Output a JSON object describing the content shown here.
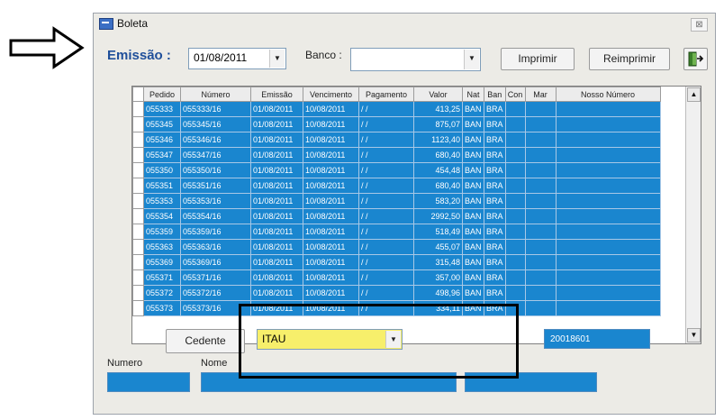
{
  "window": {
    "title": "Boleta",
    "close_glyph": "⊠"
  },
  "filter": {
    "emissao_label": "Emissão :",
    "emissao_value": "01/08/2011",
    "banco_label": "Banco :",
    "banco_value": ""
  },
  "toolbar": {
    "imprimir_label": "Imprimir",
    "reimprimir_label": "Reimprimir",
    "exit_icon": "exit-door-icon"
  },
  "grid": {
    "columns": [
      "Pedido",
      "Número",
      "Emissão",
      "Vencimento",
      "Pagamento",
      "Valor",
      "Nat",
      "Ban",
      "Con",
      "Mar",
      "Nosso Número"
    ],
    "rows": [
      [
        "055333",
        "055333/16",
        "01/08/2011",
        "10/08/2011",
        "/ /",
        "413,25",
        "BAN",
        "BRA",
        "",
        "",
        ""
      ],
      [
        "055345",
        "055345/16",
        "01/08/2011",
        "10/08/2011",
        "/ /",
        "875,07",
        "BAN",
        "BRA",
        "",
        "",
        ""
      ],
      [
        "055346",
        "055346/16",
        "01/08/2011",
        "10/08/2011",
        "/ /",
        "1123,40",
        "BAN",
        "BRA",
        "",
        "",
        ""
      ],
      [
        "055347",
        "055347/16",
        "01/08/2011",
        "10/08/2011",
        "/ /",
        "680,40",
        "BAN",
        "BRA",
        "",
        "",
        ""
      ],
      [
        "055350",
        "055350/16",
        "01/08/2011",
        "10/08/2011",
        "/ /",
        "454,48",
        "BAN",
        "BRA",
        "",
        "",
        ""
      ],
      [
        "055351",
        "055351/16",
        "01/08/2011",
        "10/08/2011",
        "/ /",
        "680,40",
        "BAN",
        "BRA",
        "",
        "",
        ""
      ],
      [
        "055353",
        "055353/16",
        "01/08/2011",
        "10/08/2011",
        "/ /",
        "583,20",
        "BAN",
        "BRA",
        "",
        "",
        ""
      ],
      [
        "055354",
        "055354/16",
        "01/08/2011",
        "10/08/2011",
        "/ /",
        "2992,50",
        "BAN",
        "BRA",
        "",
        "",
        ""
      ],
      [
        "055359",
        "055359/16",
        "01/08/2011",
        "10/08/2011",
        "/ /",
        "518,49",
        "BAN",
        "BRA",
        "",
        "",
        ""
      ],
      [
        "055363",
        "055363/16",
        "01/08/2011",
        "10/08/2011",
        "/ /",
        "455,07",
        "BAN",
        "BRA",
        "",
        "",
        ""
      ],
      [
        "055369",
        "055369/16",
        "01/08/2011",
        "10/08/2011",
        "/ /",
        "315,48",
        "BAN",
        "BRA",
        "",
        "",
        ""
      ],
      [
        "055371",
        "055371/16",
        "01/08/2011",
        "10/08/2011",
        "/ /",
        "357,00",
        "BAN",
        "BRA",
        "",
        "",
        ""
      ],
      [
        "055372",
        "055372/16",
        "01/08/2011",
        "10/08/2011",
        "/ /",
        "498,96",
        "BAN",
        "BRA",
        "",
        "",
        ""
      ],
      [
        "055373",
        "055373/16",
        "01/08/2011",
        "10/08/2011",
        "/ /",
        "334,11",
        "BAN",
        "BRA",
        "",
        "",
        ""
      ]
    ]
  },
  "bottom": {
    "cedente_label": "Cedente",
    "cedente_value": "ITAU",
    "nosso_numero_value": "20018601",
    "numero_label": "Numero",
    "nome_label": "Nome"
  },
  "colors": {
    "grid_row": "#1a86cf",
    "highlight_field": "#f7ef6b",
    "title_accent": "#1f4f9a"
  }
}
